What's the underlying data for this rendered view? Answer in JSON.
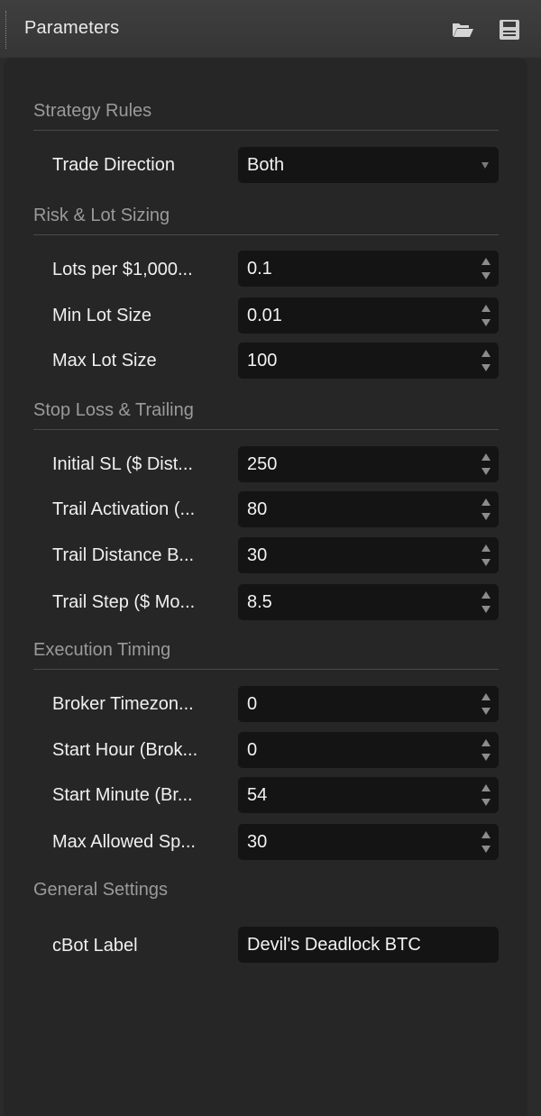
{
  "header": {
    "title": "Parameters",
    "icons": [
      "folder-open-icon",
      "save-icon"
    ]
  },
  "sections": {
    "strategy": {
      "title": "Strategy Rules",
      "trade_direction": {
        "label": "Trade Direction",
        "value": "Both"
      }
    },
    "risk": {
      "title": "Risk & Lot Sizing",
      "lots_per": {
        "label": "Lots per $1,000...",
        "value": "0.1"
      },
      "min_lot": {
        "label": "Min Lot Size",
        "value": "0.01"
      },
      "max_lot": {
        "label": "Max Lot Size",
        "value": "100"
      }
    },
    "stop_loss": {
      "title": "Stop Loss & Trailing",
      "initial_sl": {
        "label": "Initial SL ($ Dist...",
        "value": "250"
      },
      "trail_activation": {
        "label": "Trail Activation (...",
        "value": "80"
      },
      "trail_distance": {
        "label": "Trail Distance B...",
        "value": "30"
      },
      "trail_step": {
        "label": "Trail Step ($ Mo...",
        "value": "8.5"
      }
    },
    "timing": {
      "title": "Execution Timing",
      "broker_tz": {
        "label": "Broker Timezon...",
        "value": "0"
      },
      "start_hour": {
        "label": "Start Hour (Brok...",
        "value": "0"
      },
      "start_minute": {
        "label": "Start Minute (Br...",
        "value": "54"
      },
      "max_spread": {
        "label": "Max Allowed Sp...",
        "value": "30"
      }
    },
    "general": {
      "title": "General Settings",
      "cbot_label": {
        "label": "cBot Label",
        "value": "Devil's Deadlock BTC"
      }
    }
  },
  "colors": {
    "header_bg": "#3a3a3a",
    "panel_bg": "#262626",
    "field_bg": "#141414",
    "section_title": "#9a9a9a",
    "text": "#f0f0f0"
  }
}
